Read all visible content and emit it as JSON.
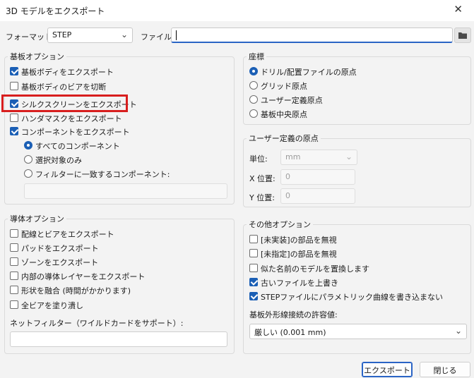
{
  "window": {
    "title": "3D モデルをエクスポート",
    "close_glyph": "✕"
  },
  "format": {
    "label": "フォーマット:",
    "value": "STEP"
  },
  "file": {
    "label": "ファイル:",
    "value": ""
  },
  "board_options": {
    "title": "基板オプション",
    "export_board_body": {
      "label": "基板ボディをエクスポート",
      "checked": true
    },
    "cut_vias": {
      "label": "基板ボディのビアを切断",
      "checked": false
    },
    "export_silkscreen": {
      "label": "シルクスクリーンをエクスポート",
      "checked": true
    },
    "export_soldermask": {
      "label": "ハンダマスクをエクスポート",
      "checked": false
    },
    "export_components": {
      "label": "コンポーネントをエクスポート",
      "checked": true
    },
    "all_components": {
      "label": "すべてのコンポーネント",
      "selected": true
    },
    "selected_only": {
      "label": "選択対象のみ",
      "selected": false
    },
    "filter_match": {
      "label": "フィルターに一致するコンポーネント:",
      "selected": false
    },
    "filter_value": ""
  },
  "coordinates": {
    "title": "座標",
    "options": [
      {
        "label": "ドリル/配置ファイルの原点",
        "selected": true
      },
      {
        "label": "グリッド原点",
        "selected": false
      },
      {
        "label": "ユーザー定義原点",
        "selected": false
      },
      {
        "label": "基板中央原点",
        "selected": false
      }
    ]
  },
  "user_origin": {
    "title": "ユーザー定義の原点",
    "unit_label": "単位:",
    "unit_value": "mm",
    "x_label": "X 位置:",
    "x_value": "0",
    "y_label": "Y 位置:",
    "y_value": "0"
  },
  "conductor_options": {
    "title": "導体オプション",
    "items": [
      {
        "label": "配線とビアをエクスポート",
        "checked": false
      },
      {
        "label": "パッドをエクスポート",
        "checked": false
      },
      {
        "label": "ゾーンをエクスポート",
        "checked": false
      },
      {
        "label": "内部の導体レイヤーをエクスポート",
        "checked": false
      },
      {
        "label": "形状を融合 (時間がかかります)",
        "checked": false
      },
      {
        "label": "全ビアを塗り潰し",
        "checked": false
      }
    ],
    "net_filter_label": "ネットフィルター（ワイルドカードをサポート）:",
    "net_filter_value": ""
  },
  "other_options": {
    "title": "その他オプション",
    "items": [
      {
        "label": "[未実装]の部品を無視",
        "checked": false
      },
      {
        "label": "[未指定]の部品を無視",
        "checked": false
      },
      {
        "label": "似た名前のモデルを置換します",
        "checked": false
      },
      {
        "label": "古いファイルを上書き",
        "checked": true
      },
      {
        "label": "STEPファイルにパラメトリック曲線を書き込まない",
        "checked": true
      }
    ],
    "tolerance_label": "基板外形線接続の許容値:",
    "tolerance_value": "厳しい (0.001 mm)"
  },
  "buttons": {
    "export": "エクスポート",
    "close": "閉じる"
  },
  "colors": {
    "accent": "#1b5fb5",
    "highlight": "#d81e1e",
    "background": "#f3f3f3"
  }
}
